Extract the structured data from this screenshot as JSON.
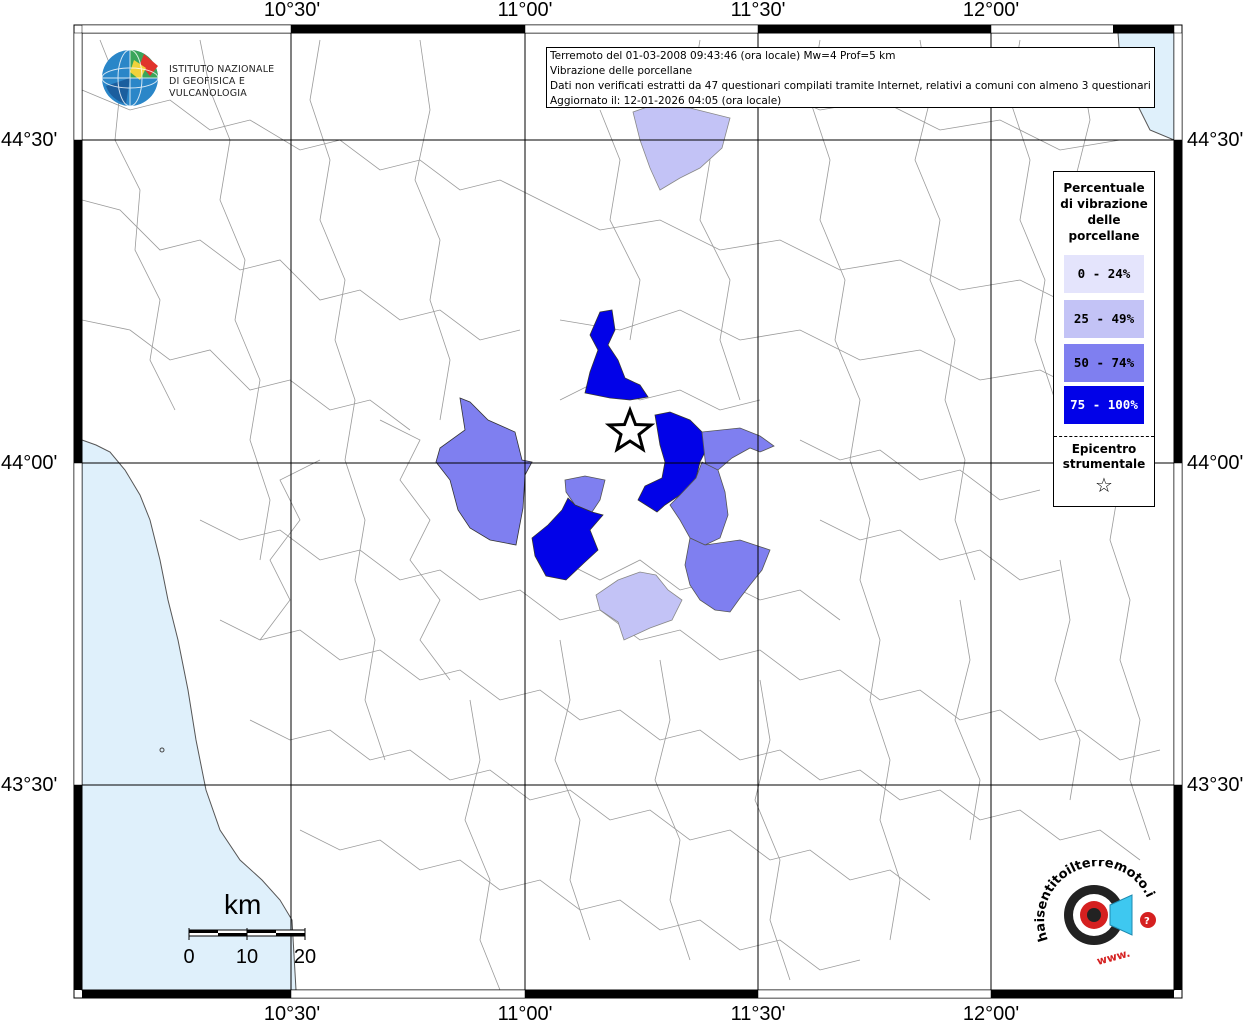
{
  "map": {
    "lon_ticks_top": [
      "10°30'",
      "11°00'",
      "11°30'",
      "12°00'"
    ],
    "lon_ticks_bottom": [
      "10°30'",
      "11°00'",
      "11°30'",
      "12°00'"
    ],
    "lat_ticks_left": [
      "44°30'",
      "44°00'",
      "43°30'"
    ],
    "lat_ticks_right": [
      "44°30'",
      "44°00'",
      "43°30'"
    ]
  },
  "logo": {
    "line1": "ISTITUTO NAZIONALE",
    "line2": "DI GEOFISICA E VULCANOLOGIA"
  },
  "info": {
    "line1": "Terremoto del 01-03-2008 09:43:46 (ora locale) Mw=4 Prof=5 km",
    "line2": "Vibrazione delle porcellane",
    "line3": "Dati non verificati estratti da 47 questionari compilati tramite Internet, relativi a comuni con almeno 3 questionari.",
    "line4": "Aggiornato il: 12-01-2026 04:05 (ora locale)"
  },
  "legend": {
    "title_lines": [
      "Percentuale",
      "di vibrazione",
      "delle",
      "porcellane"
    ],
    "classes": [
      {
        "label": "0 - 24%",
        "color": "#e4e4fc"
      },
      {
        "label": "25 - 49%",
        "color": "#c3c3f6"
      },
      {
        "label": "50 - 74%",
        "color": "#7f7ff0"
      },
      {
        "label": "75 - 100%",
        "color": "#0202e8"
      }
    ],
    "epicenter_line1": "Epicentro",
    "epicenter_line2": "strumentale",
    "epicenter_symbol": "☆"
  },
  "scale_bar": {
    "unit": "km",
    "ticks": [
      "0",
      "10",
      "20"
    ]
  },
  "colors": {
    "sea": "#dff0fb",
    "border_lines": "#8c8c8c",
    "grid": "#000000"
  },
  "watermark": {
    "text": "haisentitoilterremoto.it",
    "brand_name": "www.haisentitoilterremoto.it",
    "icon": "seismic-target-icon"
  }
}
